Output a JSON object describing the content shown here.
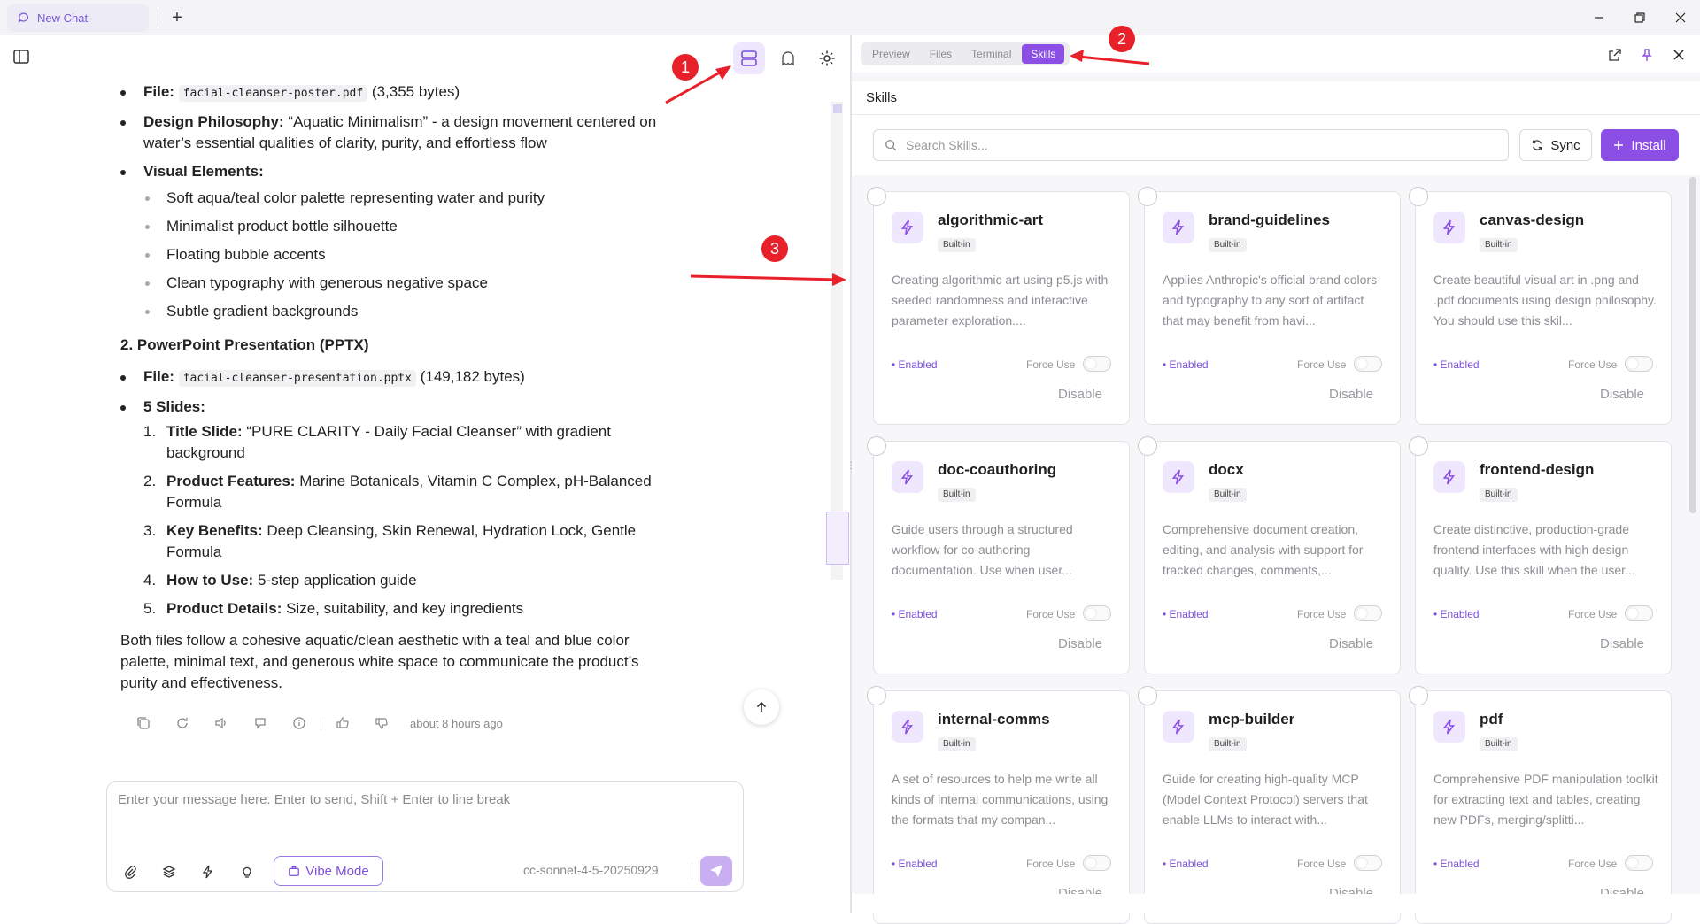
{
  "titlebar": {
    "tab_label": "New Chat",
    "new_tab": "+"
  },
  "message": {
    "file1_label": "File:",
    "file1_name": "facial-cleanser-poster.pdf",
    "file1_size": "(3,355 bytes)",
    "philosophy_label": "Design Philosophy:",
    "philosophy_text": "“Aquatic Minimalism” - a design movement centered on water’s essential qualities of clarity, purity, and effortless flow",
    "visual_label": "Visual Elements:",
    "visual_items": [
      "Soft aqua/teal color palette representing water and purity",
      "Minimalist product bottle silhouette",
      "Floating bubble accents",
      "Clean typography with generous negative space",
      "Subtle gradient backgrounds"
    ],
    "section2_title": "2. PowerPoint Presentation (PPTX)",
    "file2_label": "File:",
    "file2_name": "facial-cleanser-presentation.pptx",
    "file2_size": "(149,182 bytes)",
    "slides_label": "5 Slides:",
    "slides": [
      {
        "num": "1.",
        "label": "Title Slide:",
        "text": "“PURE CLARITY - Daily Facial Cleanser” with gradient background"
      },
      {
        "num": "2.",
        "label": "Product Features:",
        "text": "Marine Botanicals, Vitamin C Complex, pH-Balanced Formula"
      },
      {
        "num": "3.",
        "label": "Key Benefits:",
        "text": "Deep Cleansing, Skin Renewal, Hydration Lock, Gentle Formula"
      },
      {
        "num": "4.",
        "label": "How to Use:",
        "text": "5-step application guide"
      },
      {
        "num": "5.",
        "label": "Product Details:",
        "text": "Size, suitability, and key ingredients"
      }
    ],
    "summary": "Both files follow a cohesive aquatic/clean aesthetic with a teal and blue color palette, minimal text, and generous white space to communicate the product’s purity and effectiveness.",
    "timestamp": "about 8 hours ago"
  },
  "composer": {
    "placeholder": "Enter your message here. Enter to send, Shift + Enter to line break",
    "vibe_label": "Vibe Mode",
    "model": "cc-sonnet-4-5-20250929"
  },
  "annotations": {
    "one": "1",
    "two": "2",
    "three": "3"
  },
  "right_panel": {
    "tabs": [
      "Preview",
      "Files",
      "Terminal",
      "Skills"
    ],
    "active_tab": "Skills",
    "header": "Skills",
    "search_placeholder": "Search Skills...",
    "sync_label": "Sync",
    "install_label": "Install"
  },
  "skills": [
    {
      "name": "algorithmic-art",
      "tag": "Built-in",
      "desc": "Creating algorithmic art using p5.js with seeded randomness and interactive parameter exploration....",
      "status": "Enabled",
      "force": "Force Use",
      "action": "Disable"
    },
    {
      "name": "brand-guidelines",
      "tag": "Built-in",
      "desc": "Applies Anthropic's official brand colors and typography to any sort of artifact that may benefit from havi...",
      "status": "Enabled",
      "force": "Force Use",
      "action": "Disable"
    },
    {
      "name": "canvas-design",
      "tag": "Built-in",
      "desc": "Create beautiful visual art in .png and .pdf documents using design philosophy. You should use this skil...",
      "status": "Enabled",
      "force": "Force Use",
      "action": "Disable"
    },
    {
      "name": "doc-coauthoring",
      "tag": "Built-in",
      "desc": "Guide users through a structured workflow for co-authoring documentation. Use when user...",
      "status": "Enabled",
      "force": "Force Use",
      "action": "Disable"
    },
    {
      "name": "docx",
      "tag": "Built-in",
      "desc": "Comprehensive document creation, editing, and analysis with support for tracked changes, comments,...",
      "status": "Enabled",
      "force": "Force Use",
      "action": "Disable"
    },
    {
      "name": "frontend-design",
      "tag": "Built-in",
      "desc": "Create distinctive, production-grade frontend interfaces with high design quality. Use this skill when the user...",
      "status": "Enabled",
      "force": "Force Use",
      "action": "Disable"
    },
    {
      "name": "internal-comms",
      "tag": "Built-in",
      "desc": "A set of resources to help me write all kinds of internal communications, using the formats that my compan...",
      "status": "Enabled",
      "force": "Force Use",
      "action": "Disable"
    },
    {
      "name": "mcp-builder",
      "tag": "Built-in",
      "desc": "Guide for creating high-quality MCP (Model Context Protocol) servers that enable LLMs to interact with...",
      "status": "Enabled",
      "force": "Force Use",
      "action": "Disable"
    },
    {
      "name": "pdf",
      "tag": "Built-in",
      "desc": "Comprehensive PDF manipulation toolkit for extracting text and tables, creating new PDFs, merging/splitti...",
      "status": "Enabled",
      "force": "Force Use",
      "action": "Disable"
    }
  ],
  "colors": {
    "accent": "#8b4fe6",
    "annotation": "#e8202a"
  }
}
